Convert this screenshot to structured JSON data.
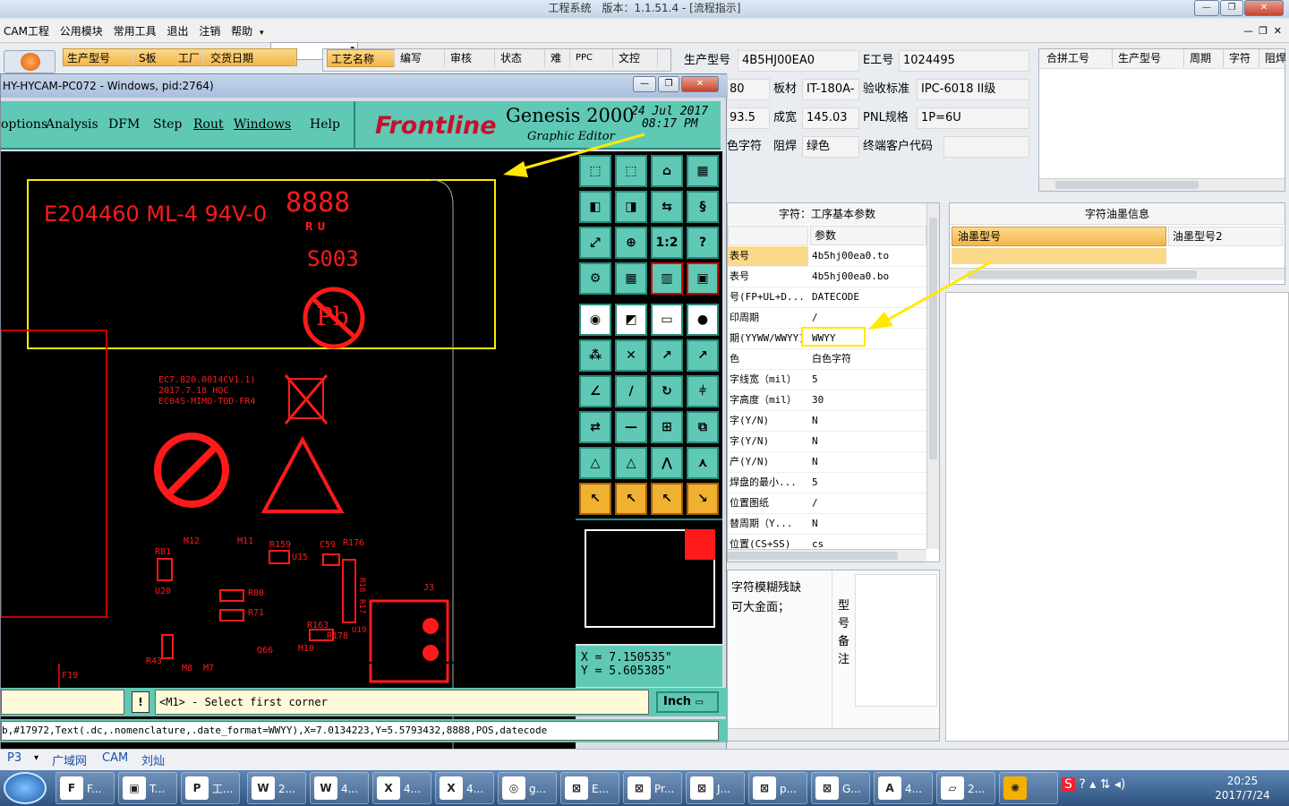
{
  "app": {
    "title": "工程系统　版本：1.1.51.4 - [流程指示]"
  },
  "menu": [
    "CAM工程",
    "公用模块",
    "常用工具",
    "退出",
    "注销",
    "帮助"
  ],
  "grid1": {
    "headers": [
      "生产型号",
      "S板",
      "工厂",
      "交货日期"
    ]
  },
  "grid2": {
    "headers": [
      "工艺名称",
      "编写",
      "审核",
      "状态",
      "难",
      "PPC",
      "文控"
    ]
  },
  "info": {
    "prod_model_label": "生产型号",
    "prod_model": "4B5HJ00EA0",
    "e_no_label": "E工号",
    "e_no": "1024495",
    "v1": "80",
    "board_label": "板材",
    "board": "IT-180A-",
    "accept_label": "验收标准",
    "accept": "IPC-6018 II级",
    "v2": "93.5",
    "width_label": "成宽",
    "width": "145.03",
    "pnl_label": "PNL规格",
    "pnl": "1P=6U",
    "color_label": "色字符",
    "mask_label": "阻焊",
    "mask": "绿色",
    "cust_label": "终端客户代码",
    "cust": ""
  },
  "merge": {
    "headers": [
      "合拼工号",
      "生产型号",
      "周期",
      "字符",
      "阻焊"
    ]
  },
  "params": {
    "title": "字符：工序基本参数",
    "col": "参数",
    "rows": [
      {
        "k": "表号",
        "v": "4b5hj00ea0.to"
      },
      {
        "k": "表号",
        "v": "4b5hj00ea0.bo"
      },
      {
        "k": "号(FP+UL+D...",
        "v": "DATECODE"
      },
      {
        "k": "印周期",
        "v": "/"
      },
      {
        "k": "期(YYWW/WWYY)",
        "v": "WWYY"
      },
      {
        "k": "色",
        "v": "白色字符"
      },
      {
        "k": "字线宽（mil）",
        "v": "5"
      },
      {
        "k": "字高度（mil）",
        "v": "30"
      },
      {
        "k": "字(Y/N)",
        "v": "N"
      },
      {
        "k": "字(Y/N)",
        "v": "N"
      },
      {
        "k": "产(Y/N)",
        "v": "N"
      },
      {
        "k": "焊盘的最小...",
        "v": "5"
      },
      {
        "k": "位置图纸",
        "v": "/"
      },
      {
        "k": "替周期（Y...",
        "v": "N"
      },
      {
        "k": "位置(CS+SS)",
        "v": "cs"
      }
    ]
  },
  "ink": {
    "title": "字符油墨信息",
    "cols": [
      "油墨型号",
      "油墨型号2"
    ]
  },
  "notes": {
    "text1": "字符模糊残缺",
    "text2": "可大金面；",
    "vert": [
      "型",
      "号",
      "备",
      "注"
    ]
  },
  "genesis": {
    "title": "HY-HYCAM-PC072 - Windows, pid:2764)",
    "menus": [
      "options",
      "Analysis",
      "DFM",
      "Step",
      "Rout",
      "Windows",
      "Help"
    ],
    "brand": "Frontline",
    "product": "Genesis 2000",
    "sub": "Graphic Editor",
    "date": "24 Jul 2017",
    "time": "08:17 PM",
    "x": "X = 7.150535\"",
    "y": "Y = 5.605385\"",
    "prompt": "<M1> - Select first corner",
    "units": "Inch",
    "cmd": "b,#17972,Text(.dc,.nomenclature,.date_format=WWYY),X=7.0134223,Y=5.5793432,8888,POS,datecode",
    "canvas": {
      "t1": "E204460 ML-4 94V-0",
      "t2": "8888",
      "t3": "S003",
      "t4": "Pb",
      "t5": "EC7.820.0014CV1.1)",
      "t6": "2017.7.18 HQC",
      "t7": "EC04S-MIMO-TOD-FR4",
      "labels": [
        "R81",
        "M12",
        "M11",
        "R159",
        "C59",
        "R176",
        "U20",
        "U15",
        "R80",
        "R71",
        "R163",
        "R178",
        "R43",
        "M8",
        "M7",
        "Q66",
        "M10",
        "F19",
        "J3",
        "R18",
        "R17",
        "U19"
      ]
    }
  },
  "bottomtabs": [
    "P3",
    "广域网",
    "CAM",
    "刘灿"
  ],
  "taskbar": {
    "items": [
      "F...",
      "T...",
      "工...",
      "2...",
      "4...",
      "4...",
      "4...",
      "g...",
      "E...",
      "Pr...",
      "J...",
      "p...",
      "G...",
      "4...",
      "2..."
    ],
    "clock_time": "20:25",
    "clock_date": "2017/7/24"
  }
}
